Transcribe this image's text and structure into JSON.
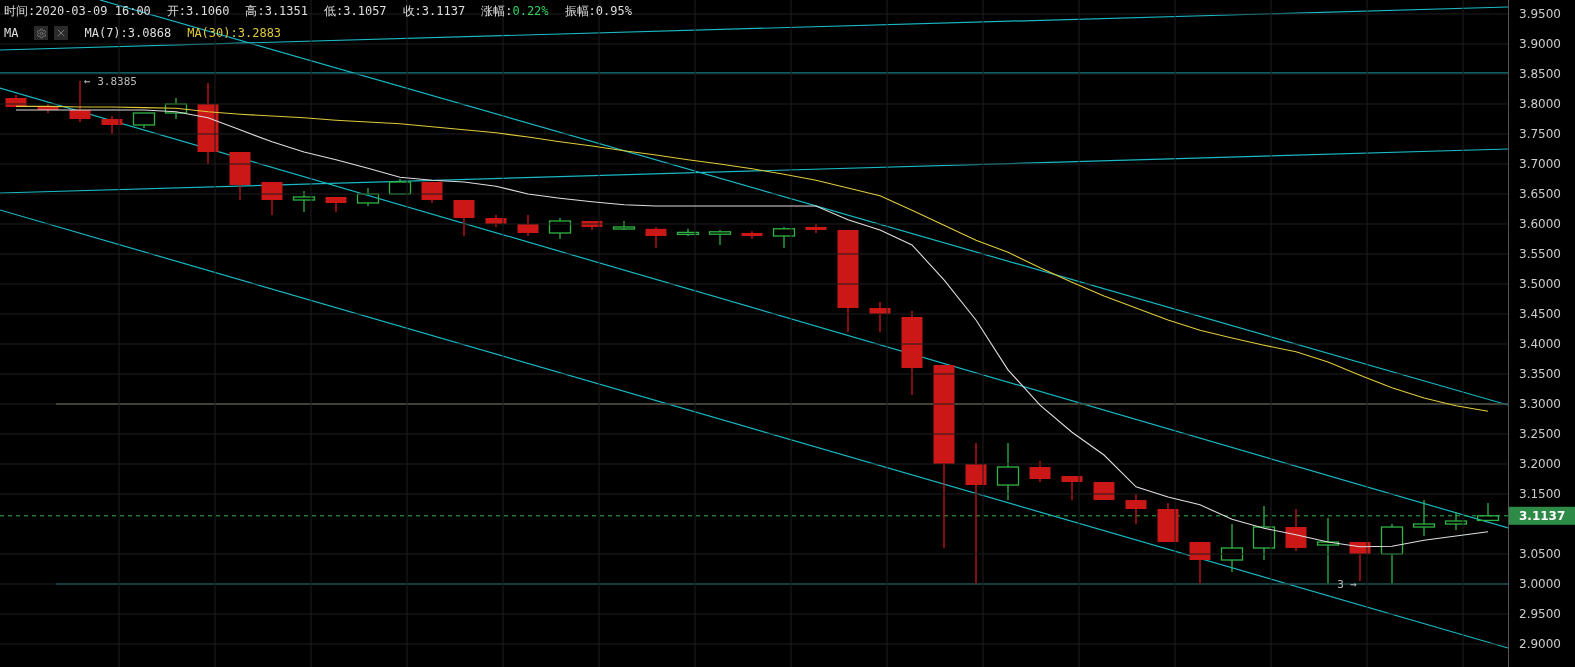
{
  "header": {
    "items": [
      {
        "label": "时间:",
        "value": "2020-03-09 16:00",
        "color": "#dddddd"
      },
      {
        "label": "开:",
        "value": "3.1060",
        "color": "#dddddd"
      },
      {
        "label": "高:",
        "value": "3.1351",
        "color": "#dddddd"
      },
      {
        "label": "低:",
        "value": "3.1057",
        "color": "#dddddd"
      },
      {
        "label": "收:",
        "value": "3.1137",
        "color": "#dddddd"
      },
      {
        "label": "涨幅:",
        "value": "0.22%",
        "color": "#2fd35c"
      },
      {
        "label": "振幅:",
        "value": "0.95%",
        "color": "#dddddd"
      }
    ],
    "indicator_label": "MA",
    "indicators": [
      {
        "value": ":3.0868"
      },
      {
        "value": ":3.2883"
      }
    ]
  },
  "chart": {
    "price_tag": "3.1137",
    "annotations": [
      {
        "text": "← 3.8385"
      },
      {
        "text": "3 →"
      }
    ],
    "chart_data": {
      "type": "line",
      "ylim": [
        2.8617,
        3.9733
      ],
      "yticks": [
        {
          "value": 2.9,
          "label": "2.9000"
        },
        {
          "value": 2.95,
          "label": "2.9500"
        },
        {
          "value": 3.0,
          "label": "3.0000"
        },
        {
          "value": 3.05,
          "label": "3.0500"
        },
        {
          "value": 3.15,
          "label": "3.1500"
        },
        {
          "value": 3.2,
          "label": "3.2000"
        },
        {
          "value": 3.25,
          "label": "3.2500"
        },
        {
          "value": 3.3,
          "label": "3.3000"
        },
        {
          "value": 3.35,
          "label": "3.3500"
        },
        {
          "value": 3.4,
          "label": "3.4000"
        },
        {
          "value": 3.45,
          "label": "3.4500"
        },
        {
          "value": 3.5,
          "label": "3.5000"
        },
        {
          "value": 3.55,
          "label": "3.5500"
        },
        {
          "value": 3.6,
          "label": "3.6000"
        },
        {
          "value": 3.65,
          "label": "3.6500"
        },
        {
          "value": 3.7,
          "label": "3.7000"
        },
        {
          "value": 3.75,
          "label": "3.7500"
        },
        {
          "value": 3.8,
          "label": "3.8000"
        },
        {
          "value": 3.85,
          "label": "3.8500"
        },
        {
          "value": 3.9,
          "label": "3.9000"
        },
        {
          "value": 3.95,
          "label": "3.9500"
        }
      ],
      "series": [
        {
          "name": "MA(7)",
          "color": "#dddddd",
          "values": [
            3.79,
            3.79,
            3.79,
            3.79,
            3.79,
            3.787,
            3.777,
            3.757,
            3.737,
            3.72,
            3.707,
            3.693,
            3.678,
            3.673,
            3.67,
            3.663,
            3.65,
            3.643,
            3.637,
            3.632,
            3.63,
            3.63,
            3.63,
            3.63,
            3.63,
            3.63,
            3.607,
            3.59,
            3.565,
            3.507,
            3.44,
            3.357,
            3.298,
            3.253,
            3.215,
            3.162,
            3.145,
            3.132,
            3.108,
            3.093,
            3.082,
            3.07,
            3.062,
            3.063,
            3.073,
            3.08,
            3.087
          ]
        },
        {
          "name": "MA(30)",
          "color": "#e0c93a",
          "values": [
            3.796,
            3.796,
            3.795,
            3.795,
            3.794,
            3.793,
            3.787,
            3.783,
            3.78,
            3.777,
            3.773,
            3.77,
            3.767,
            3.762,
            3.757,
            3.752,
            3.745,
            3.737,
            3.73,
            3.722,
            3.715,
            3.707,
            3.7,
            3.692,
            3.683,
            3.673,
            3.66,
            3.647,
            3.623,
            3.598,
            3.573,
            3.553,
            3.527,
            3.503,
            3.48,
            3.46,
            3.44,
            3.423,
            3.41,
            3.398,
            3.387,
            3.37,
            3.348,
            3.327,
            3.31,
            3.297,
            3.288
          ]
        }
      ],
      "grid": true
    }
  }
}
